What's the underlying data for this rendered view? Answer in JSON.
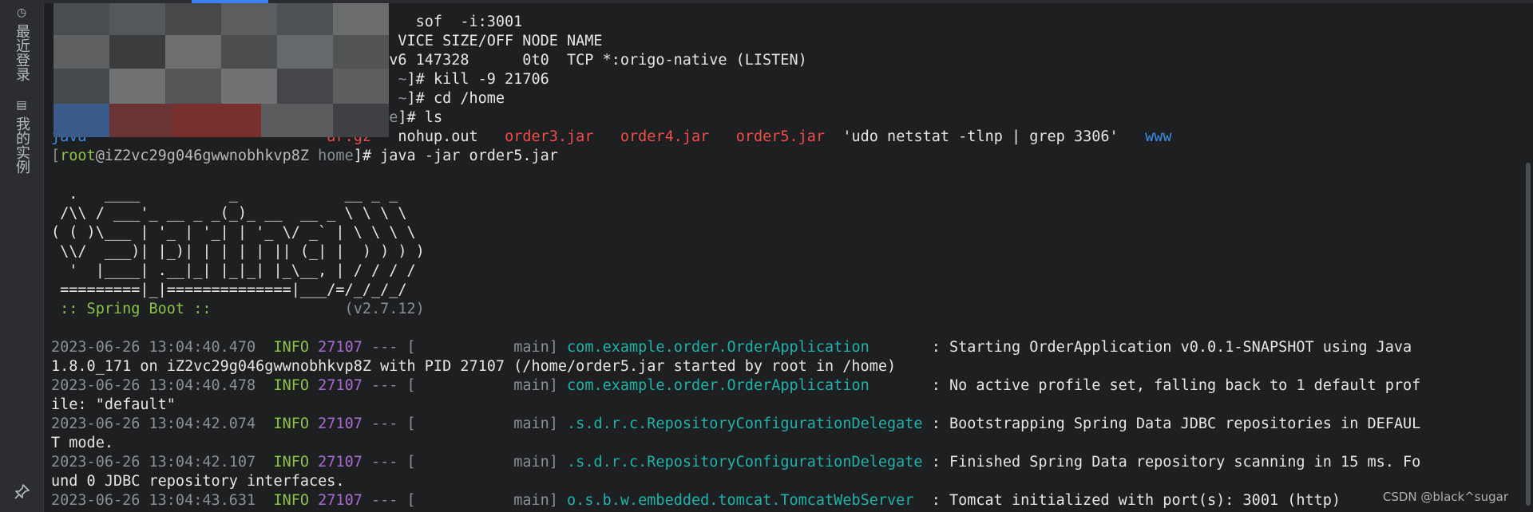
{
  "sidebar": {
    "tabs": [
      {
        "label": "最近登录",
        "icon": "clock-icon"
      },
      {
        "label": "我的实例",
        "icon": "server-icon"
      }
    ],
    "pin_icon": "pin-icon"
  },
  "terminal": {
    "lines": [
      {
        "segments": [
          {
            "t": "                                         sof  -i:3001",
            "c": "white"
          }
        ]
      },
      {
        "segments": [
          {
            "t": "                                       VICE SIZE/OFF NODE NAME",
            "c": "white"
          }
        ]
      },
      {
        "segments": [
          {
            "t": "                                     Pv6 147328      0t0  TCP *:origo-native (LISTEN)",
            "c": "white"
          }
        ]
      },
      {
        "segments": [
          {
            "t": "                                     Z ",
            "c": "white"
          },
          {
            "t": "~",
            "c": "gray"
          },
          {
            "t": "]# kill -9 21706",
            "c": "white"
          }
        ]
      },
      {
        "segments": [
          {
            "t": "                                       ",
            "c": "white"
          },
          {
            "t": "~",
            "c": "gray"
          },
          {
            "t": "]# cd /home",
            "c": "white"
          }
        ]
      },
      {
        "segments": [
          {
            "t": "                                    ",
            "c": "white"
          },
          {
            "t": "ome",
            "c": "gray"
          },
          {
            "t": "]# ls",
            "c": "white"
          }
        ]
      },
      {
        "segments": [
          {
            "t": "java",
            "c": "blue"
          },
          {
            "t": "                           ",
            "c": "white"
          },
          {
            "t": "ar.gz",
            "c": "red"
          },
          {
            "t": "   nohup.out   ",
            "c": "white"
          },
          {
            "t": "order3.jar",
            "c": "red"
          },
          {
            "t": "   ",
            "c": "white"
          },
          {
            "t": "order4.jar",
            "c": "red"
          },
          {
            "t": "   ",
            "c": "white"
          },
          {
            "t": "order5.jar",
            "c": "red"
          },
          {
            "t": "  'udo netstat -tlnp | grep 3306'   ",
            "c": "white"
          },
          {
            "t": "www",
            "c": "blue"
          }
        ]
      },
      {
        "segments": [
          {
            "t": "[",
            "c": "gray"
          },
          {
            "t": "root",
            "c": "green"
          },
          {
            "t": "@iZ2vc29g046gwwnobhkvp8Z ",
            "c": "host"
          },
          {
            "t": "home",
            "c": "gray"
          },
          {
            "t": "]# java -jar order5.jar",
            "c": "white"
          }
        ]
      },
      {
        "segments": [
          {
            "t": "",
            "c": "white"
          }
        ]
      },
      {
        "segments": [
          {
            "t": "  .   ____          _            __ _ _",
            "c": "white"
          }
        ]
      },
      {
        "segments": [
          {
            "t": " /\\\\ / ___'_ __ _ _(_)_ __  __ _ \\ \\ \\ \\",
            "c": "white"
          }
        ]
      },
      {
        "segments": [
          {
            "t": "( ( )\\___ | '_ | '_| | '_ \\/ _` | \\ \\ \\ \\",
            "c": "white"
          }
        ]
      },
      {
        "segments": [
          {
            "t": " \\\\/  ___)| |_)| | | | | || (_| |  ) ) ) )",
            "c": "white"
          }
        ]
      },
      {
        "segments": [
          {
            "t": "  '  |____| .__|_| |_|_| |_\\__, | / / / /",
            "c": "white"
          }
        ]
      },
      {
        "segments": [
          {
            "t": " =========|_|==============|___/=/_/_/_/",
            "c": "white"
          }
        ]
      },
      {
        "segments": [
          {
            "t": " :: Spring Boot ::",
            "c": "green"
          },
          {
            "t": "               (v2.7.12)",
            "c": "gray"
          }
        ]
      },
      {
        "segments": [
          {
            "t": "",
            "c": "white"
          }
        ]
      },
      {
        "segments": [
          {
            "t": "2023-06-26 13:04:40.470",
            "c": "gray"
          },
          {
            "t": "  INFO ",
            "c": "green"
          },
          {
            "t": "27107",
            "c": "purple"
          },
          {
            "t": " --- [           main] ",
            "c": "gray"
          },
          {
            "t": "com.example.order.OrderApplication      ",
            "c": "cyan"
          },
          {
            "t": " : Starting OrderApplication v0.0.1-SNAPSHOT using Java",
            "c": "white"
          }
        ]
      },
      {
        "segments": [
          {
            "t": "1.8.0_171 on iZ2vc29g046gwwnobhkvp8Z with PID 27107 (/home/order5.jar started by root in /home)",
            "c": "white"
          }
        ]
      },
      {
        "segments": [
          {
            "t": "2023-06-26 13:04:40.478",
            "c": "gray"
          },
          {
            "t": "  INFO ",
            "c": "green"
          },
          {
            "t": "27107",
            "c": "purple"
          },
          {
            "t": " --- [           main] ",
            "c": "gray"
          },
          {
            "t": "com.example.order.OrderApplication      ",
            "c": "cyan"
          },
          {
            "t": " : No active profile set, falling back to 1 default prof",
            "c": "white"
          }
        ]
      },
      {
        "segments": [
          {
            "t": "ile: \"default\"",
            "c": "white"
          }
        ]
      },
      {
        "segments": [
          {
            "t": "2023-06-26 13:04:42.074",
            "c": "gray"
          },
          {
            "t": "  INFO ",
            "c": "green"
          },
          {
            "t": "27107",
            "c": "purple"
          },
          {
            "t": " --- [           main] ",
            "c": "gray"
          },
          {
            "t": ".s.d.r.c.RepositoryConfigurationDelegate",
            "c": "cyan"
          },
          {
            "t": " : Bootstrapping Spring Data JDBC repositories in DEFAUL",
            "c": "white"
          }
        ]
      },
      {
        "segments": [
          {
            "t": "T mode.",
            "c": "white"
          }
        ]
      },
      {
        "segments": [
          {
            "t": "2023-06-26 13:04:42.107",
            "c": "gray"
          },
          {
            "t": "  INFO ",
            "c": "green"
          },
          {
            "t": "27107",
            "c": "purple"
          },
          {
            "t": " --- [           main] ",
            "c": "gray"
          },
          {
            "t": ".s.d.r.c.RepositoryConfigurationDelegate",
            "c": "cyan"
          },
          {
            "t": " : Finished Spring Data repository scanning in 15 ms. Fo",
            "c": "white"
          }
        ]
      },
      {
        "segments": [
          {
            "t": "und 0 JDBC repository interfaces.",
            "c": "white"
          }
        ]
      },
      {
        "segments": [
          {
            "t": "2023-06-26 13:04:43.631",
            "c": "gray"
          },
          {
            "t": "  INFO ",
            "c": "green"
          },
          {
            "t": "27107",
            "c": "purple"
          },
          {
            "t": " --- [           main] ",
            "c": "gray"
          },
          {
            "t": "o.s.b.w.embedded.tomcat.TomcatWebServer ",
            "c": "cyan"
          },
          {
            "t": " : Tomcat initialized with port(s): 3001 (http)",
            "c": "white"
          }
        ]
      }
    ]
  },
  "watermark": "CSDN @black^sugar",
  "colors": {
    "background": "#1e1f20",
    "sidebar": "#2b2d30",
    "green": "#8bc34a",
    "purple": "#a66bd6",
    "cyan": "#20b2aa",
    "red": "#f14c4c",
    "blue": "#3b8eea"
  }
}
